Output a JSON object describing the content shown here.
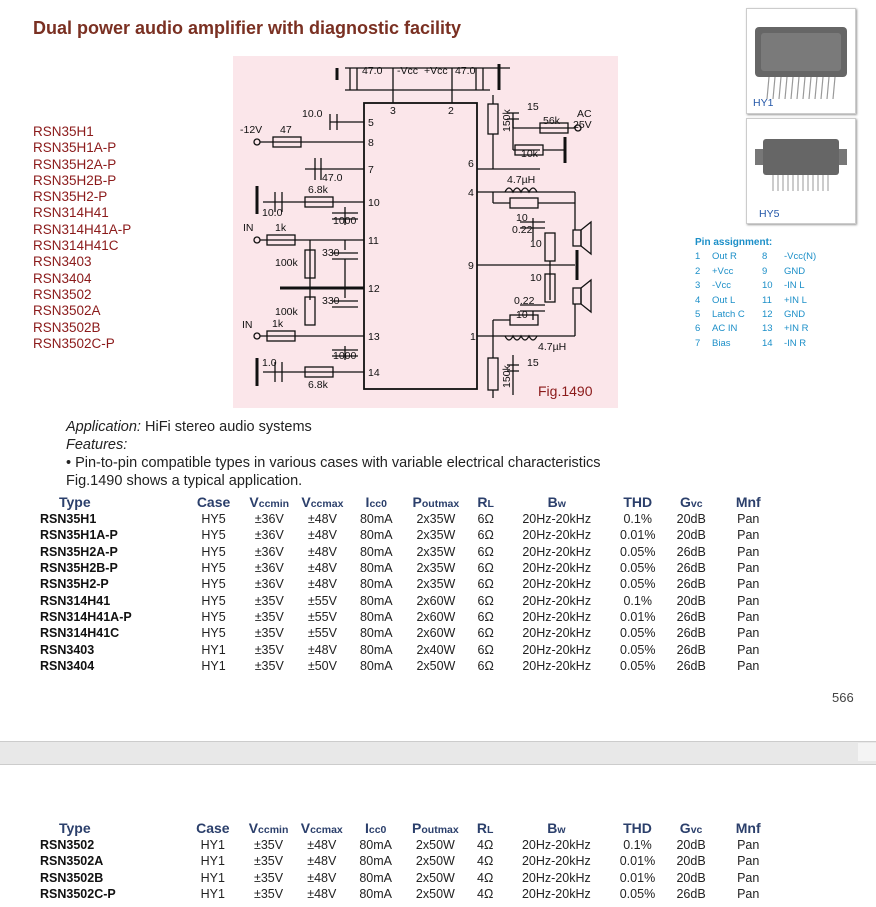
{
  "title": "Dual power audio amplifier with diagnostic facility",
  "type_list": [
    "RSN35H1",
    "RSN35H1A-P",
    "RSN35H2A-P",
    "RSN35H2B-P",
    "RSN35H2-P",
    "RSN314H41",
    "RSN314H41A-P",
    "RSN314H41C",
    "RSN3403",
    "RSN3404",
    "RSN3502",
    "RSN3502A",
    "RSN3502B",
    "RSN3502C-P"
  ],
  "packages": [
    {
      "label": "HY1"
    },
    {
      "label": "HY5"
    }
  ],
  "pin_assignment": {
    "heading": "Pin assignment:",
    "rows": [
      [
        "1",
        "Out R",
        "8",
        "-Vcc(N)"
      ],
      [
        "2",
        "+Vcc",
        "9",
        "GND"
      ],
      [
        "3",
        "-Vcc",
        "10",
        "-IN L"
      ],
      [
        "4",
        "Out L",
        "11",
        "+IN L"
      ],
      [
        "5",
        "Latch C",
        "12",
        "GND"
      ],
      [
        "6",
        "AC IN",
        "13",
        "+IN R"
      ],
      [
        "7",
        "Bias",
        "14",
        "-IN R"
      ]
    ]
  },
  "schematic": {
    "fig_label": "Fig.1490",
    "labels": {
      "c47a": "47.0",
      "vneg": "-Vcc",
      "vpos": "+Vcc",
      "c47b": "47.0",
      "pin3": "3",
      "pin2": "2",
      "pin5": "5",
      "pin8": "8",
      "pin7": "7",
      "pin10": "10",
      "pin11": "11",
      "pin12": "12",
      "pin13": "13",
      "pin14": "14",
      "pin6": "6",
      "pin4": "4",
      "pin9": "9",
      "pin1": "1",
      "m12v": "-12V",
      "r47": "47",
      "c10": "10.0",
      "c47c": "47.0",
      "r68a": "6.8k",
      "c10b": "10.0",
      "c1000a": "1000",
      "inl": "IN",
      "r1ka": "1k",
      "r100ka": "100k",
      "c330a": "330",
      "c330b": "330",
      "r100kb": "100k",
      "inr": "IN",
      "r1kb": "1k",
      "c1000b": "1000",
      "c10c": "1.0",
      "r68b": "6.8k",
      "r150ka": "150k",
      "c15a": "15",
      "r56k": "56k",
      "ac": "AC",
      "v25": "25V",
      "r10ka": "10k",
      "l47a": "4.7µH",
      "r10a": "10",
      "c022a": "0.22",
      "r10b": "10",
      "r10c": "10",
      "c022b": "0.22",
      "r10d": "10",
      "l47b": "4.7µH",
      "r150kb": "150k",
      "c15b": "15"
    }
  },
  "application": {
    "label": "Application:",
    "text": " HiFi stereo audio systems",
    "features_label": "Features:",
    "bullet": "• Pin-to-pin compatible types in various cases with variable electrical characteristics",
    "fig_note": "Fig.1490 shows a typical application."
  },
  "table_headers": [
    "Type",
    "Case",
    "Vccmin",
    "Vccmax",
    "Icc0",
    "Poutmax",
    "RL",
    "Bw",
    "THD",
    "Gvc",
    "Mnf"
  ],
  "table1": [
    [
      "RSN35H1",
      "HY5",
      "±36V",
      "±48V",
      "80mA",
      "2x35W",
      "6Ω",
      "20Hz-20kHz",
      "0.1%",
      "20dB",
      "Pan"
    ],
    [
      "RSN35H1A-P",
      "HY5",
      "±36V",
      "±48V",
      "80mA",
      "2x35W",
      "6Ω",
      "20Hz-20kHz",
      "0.01%",
      "20dB",
      "Pan"
    ],
    [
      "RSN35H2A-P",
      "HY5",
      "±36V",
      "±48V",
      "80mA",
      "2x35W",
      "6Ω",
      "20Hz-20kHz",
      "0.05%",
      "26dB",
      "Pan"
    ],
    [
      "RSN35H2B-P",
      "HY5",
      "±36V",
      "±48V",
      "80mA",
      "2x35W",
      "6Ω",
      "20Hz-20kHz",
      "0.05%",
      "26dB",
      "Pan"
    ],
    [
      "RSN35H2-P",
      "HY5",
      "±36V",
      "±48V",
      "80mA",
      "2x35W",
      "6Ω",
      "20Hz-20kHz",
      "0.05%",
      "26dB",
      "Pan"
    ],
    [
      "RSN314H41",
      "HY5",
      "±35V",
      "±55V",
      "80mA",
      "2x60W",
      "6Ω",
      "20Hz-20kHz",
      "0.1%",
      "20dB",
      "Pan"
    ],
    [
      "RSN314H41A-P",
      "HY5",
      "±35V",
      "±55V",
      "80mA",
      "2x60W",
      "6Ω",
      "20Hz-20kHz",
      "0.01%",
      "26dB",
      "Pan"
    ],
    [
      "RSN314H41C",
      "HY5",
      "±35V",
      "±55V",
      "80mA",
      "2x60W",
      "6Ω",
      "20Hz-20kHz",
      "0.05%",
      "26dB",
      "Pan"
    ],
    [
      "RSN3403",
      "HY1",
      "±35V",
      "±48V",
      "80mA",
      "2x40W",
      "6Ω",
      "20Hz-20kHz",
      "0.05%",
      "26dB",
      "Pan"
    ],
    [
      "RSN3404",
      "HY1",
      "±35V",
      "±50V",
      "80mA",
      "2x50W",
      "6Ω",
      "20Hz-20kHz",
      "0.05%",
      "26dB",
      "Pan"
    ]
  ],
  "page_number": "566",
  "table2": [
    [
      "RSN3502",
      "HY1",
      "±35V",
      "±48V",
      "80mA",
      "2x50W",
      "4Ω",
      "20Hz-20kHz",
      "0.1%",
      "20dB",
      "Pan"
    ],
    [
      "RSN3502A",
      "HY1",
      "±35V",
      "±48V",
      "80mA",
      "2x50W",
      "4Ω",
      "20Hz-20kHz",
      "0.01%",
      "20dB",
      "Pan"
    ],
    [
      "RSN3502B",
      "HY1",
      "±35V",
      "±48V",
      "80mA",
      "2x50W",
      "4Ω",
      "20Hz-20kHz",
      "0.01%",
      "20dB",
      "Pan"
    ],
    [
      "RSN3502C-P",
      "HY1",
      "±35V",
      "±48V",
      "80mA",
      "2x50W",
      "4Ω",
      "20Hz-20kHz",
      "0.05%",
      "26dB",
      "Pan"
    ]
  ]
}
